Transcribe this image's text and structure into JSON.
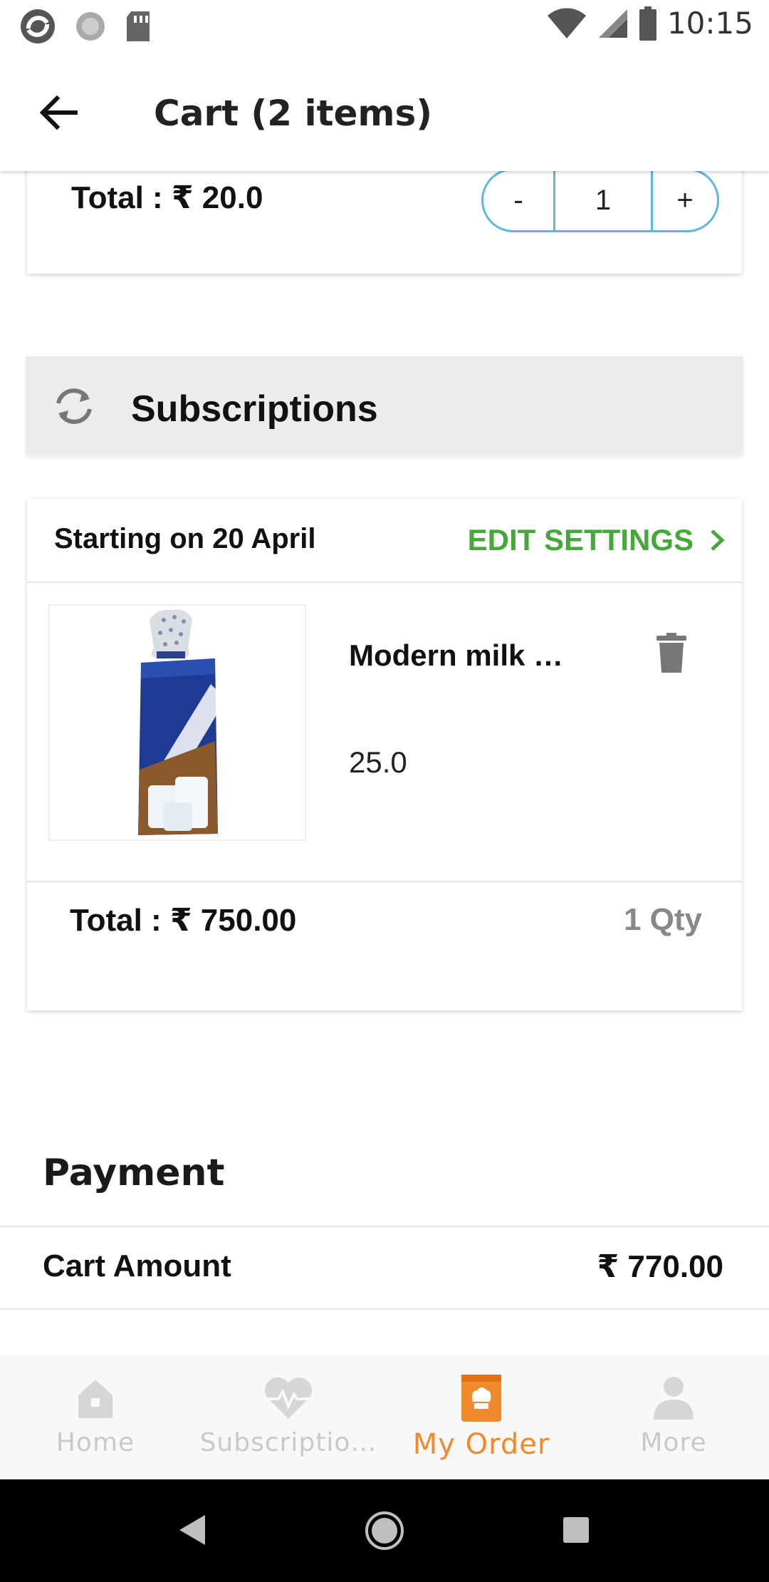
{
  "status_bar": {
    "time": "10:15"
  },
  "app_bar": {
    "title": "Cart (2 items)"
  },
  "cart_item": {
    "total": "Total : ₹ 20.0",
    "minus": "-",
    "qty": "1",
    "plus": "+"
  },
  "subscriptions": {
    "title": "Subscriptions",
    "starting": "Starting on 20 April",
    "edit_label": "EDIT SETTINGS",
    "product_name": "Modern milk …",
    "price": "25.0",
    "total": "Total : ₹ 750.00",
    "qty": "1 Qty"
  },
  "payment": {
    "title": "Payment",
    "cart_amount_label": "Cart Amount",
    "cart_amount_value": "₹ 770.00"
  },
  "bottom_nav": {
    "home": "Home",
    "subscriptions": "Subscriptio…",
    "my_order": "My Order",
    "more": "More"
  },
  "colors": {
    "accent_green": "#45a93a",
    "accent_orange": "#f08a2a",
    "stepper_blue": "#5fb6e0"
  }
}
